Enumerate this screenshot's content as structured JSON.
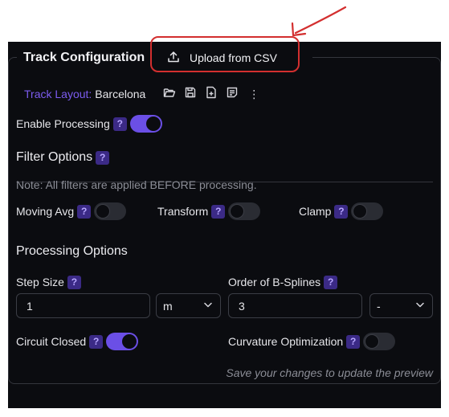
{
  "header": {
    "title": "Track Configuration",
    "upload_label": "Upload from CSV"
  },
  "track": {
    "layout_label": "Track Layout:",
    "layout_value": "Barcelona",
    "more_glyph": "⋮"
  },
  "processing_toggle": {
    "label": "Enable Processing",
    "help": "?",
    "on": true
  },
  "filter": {
    "title": "Filter Options",
    "help": "?",
    "note": "Note: All filters are applied BEFORE processing.",
    "toggles": [
      {
        "label": "Moving Avg",
        "help": "?",
        "on": false
      },
      {
        "label": "Transform",
        "help": "?",
        "on": false
      },
      {
        "label": "Clamp",
        "help": "?",
        "on": false
      }
    ]
  },
  "processing": {
    "title": "Processing Options",
    "step_size": {
      "label": "Step Size",
      "help": "?",
      "value": "1",
      "unit": "m"
    },
    "bspline": {
      "label": "Order of B-Splines",
      "help": "?",
      "value": "3",
      "option": "-"
    },
    "circuit_closed": {
      "label": "Circuit Closed",
      "help": "?",
      "on": true
    },
    "curvature": {
      "label": "Curvature Optimization",
      "help": "?",
      "on": false
    }
  },
  "footer": {
    "hint": "Save your changes to update the preview"
  },
  "colors": {
    "accent": "#6b4fe6",
    "annotation": "#d32f2f",
    "background": "#0b0c10"
  },
  "icons": [
    "upload-icon",
    "folder-open-icon",
    "save-icon",
    "file-plus-icon",
    "file-text-icon",
    "more-vertical-icon",
    "chevron-down-icon"
  ]
}
